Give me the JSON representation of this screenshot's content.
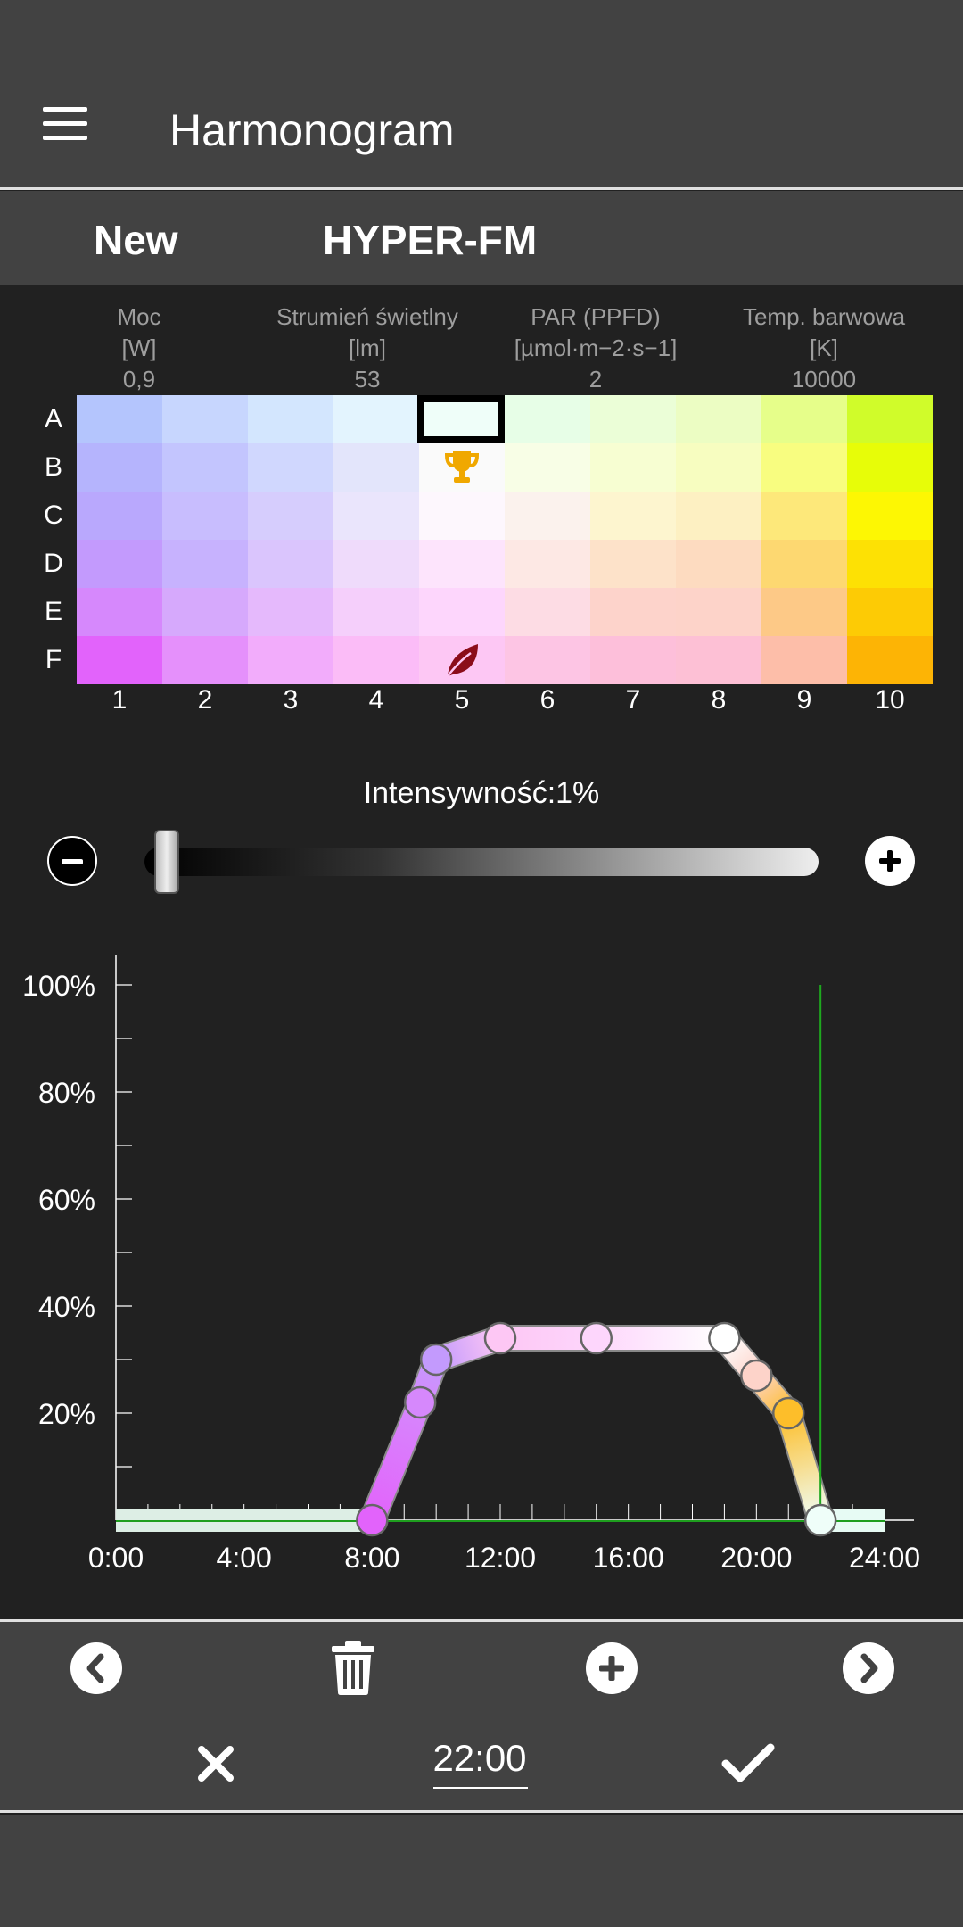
{
  "app_bar": {
    "title": "Harmonogram"
  },
  "subheader": {
    "new_label": "New",
    "device_name": "HYPER-FM"
  },
  "metrics": [
    {
      "label": "Moc",
      "unit": "[W]",
      "value": "0,9"
    },
    {
      "label": "Strumień świetlny",
      "unit": "[lm]",
      "value": "53"
    },
    {
      "label": "PAR (PPFD)",
      "unit": "[µmol·m−2·s−1]",
      "value": "2"
    },
    {
      "label": "Temp. barwowa",
      "unit": "[K]",
      "value": "10000"
    }
  ],
  "grid": {
    "rows": [
      "A",
      "B",
      "C",
      "D",
      "E",
      "F"
    ],
    "columns": [
      "1",
      "2",
      "3",
      "4",
      "5",
      "6",
      "7",
      "8",
      "9",
      "10"
    ],
    "colors": [
      [
        "#b4c5fd",
        "#c7d6fe",
        "#d3e6fe",
        "#e3f4fe",
        "#effef9",
        "#e7fee7",
        "#ebfed7",
        "#ecfdc3",
        "#e6fe8a",
        "#d0fc2a"
      ],
      [
        "#b5b4fd",
        "#c3c5fe",
        "#d0d7fe",
        "#e3e5fb",
        "#fafafa",
        "#f8fee6",
        "#f7fed2",
        "#f7fdc0",
        "#f8fd80",
        "#e7fd08"
      ],
      [
        "#b9a8fd",
        "#c8bdfe",
        "#d6cdfd",
        "#eae5fc",
        "#fdf7fd",
        "#fbf2ed",
        "#fdf5cf",
        "#fdf0c2",
        "#fde87a",
        "#fdf703"
      ],
      [
        "#c39afd",
        "#c7b2fe",
        "#dac5fd",
        "#efdbfb",
        "#fde4fc",
        "#fde8e4",
        "#fde2c9",
        "#fddbc0",
        "#fdd871",
        "#fde104"
      ],
      [
        "#d688fc",
        "#d6a9fc",
        "#e5b9fc",
        "#f5cffb",
        "#fdd6fc",
        "#fddce4",
        "#fdd3cb",
        "#fdd3c9",
        "#fdc987",
        "#fdcb05"
      ],
      [
        "#e263fb",
        "#e590fb",
        "#f2acfb",
        "#fbbcf7",
        "#fdc7f4",
        "#fdc5e4",
        "#fdbfda",
        "#fdc0d5",
        "#fdbea9",
        "#fdb405"
      ]
    ],
    "selected_cell": {
      "row": "A",
      "column": "5"
    },
    "markers": [
      {
        "row": "B",
        "column": "5",
        "icon": "trophy-icon"
      },
      {
        "row": "F",
        "column": "5",
        "icon": "leaf-icon"
      }
    ]
  },
  "intensity": {
    "label": "Intensywność:1%",
    "value_percent": 1
  },
  "chart_data": {
    "type": "line",
    "x_ticks": [
      "0:00",
      "4:00",
      "8:00",
      "12:00",
      "16:00",
      "20:00",
      "24:00"
    ],
    "y_ticks": [
      "20%",
      "40%",
      "60%",
      "80%",
      "100%"
    ],
    "xlim": [
      0,
      24
    ],
    "ylim": [
      0,
      100
    ],
    "points": [
      {
        "x": 8.0,
        "y": 0,
        "color": "#e263fb"
      },
      {
        "x": 9.5,
        "y": 22,
        "color": "#d688fc"
      },
      {
        "x": 10.0,
        "y": 30,
        "color": "#c39afd"
      },
      {
        "x": 12.0,
        "y": 34,
        "color": "#fdc7f4"
      },
      {
        "x": 15.0,
        "y": 34,
        "color": "#fdd6fc"
      },
      {
        "x": 19.0,
        "y": 34,
        "color": "#ffffff"
      },
      {
        "x": 20.0,
        "y": 27,
        "color": "#fdd3c9"
      },
      {
        "x": 21.0,
        "y": 20,
        "color": "#fdbe2a"
      },
      {
        "x": 22.0,
        "y": 0,
        "color": "#effef9"
      }
    ],
    "current_time_marker": 22,
    "grid": false
  },
  "bottom_bar": {
    "time_value": "22:00"
  }
}
